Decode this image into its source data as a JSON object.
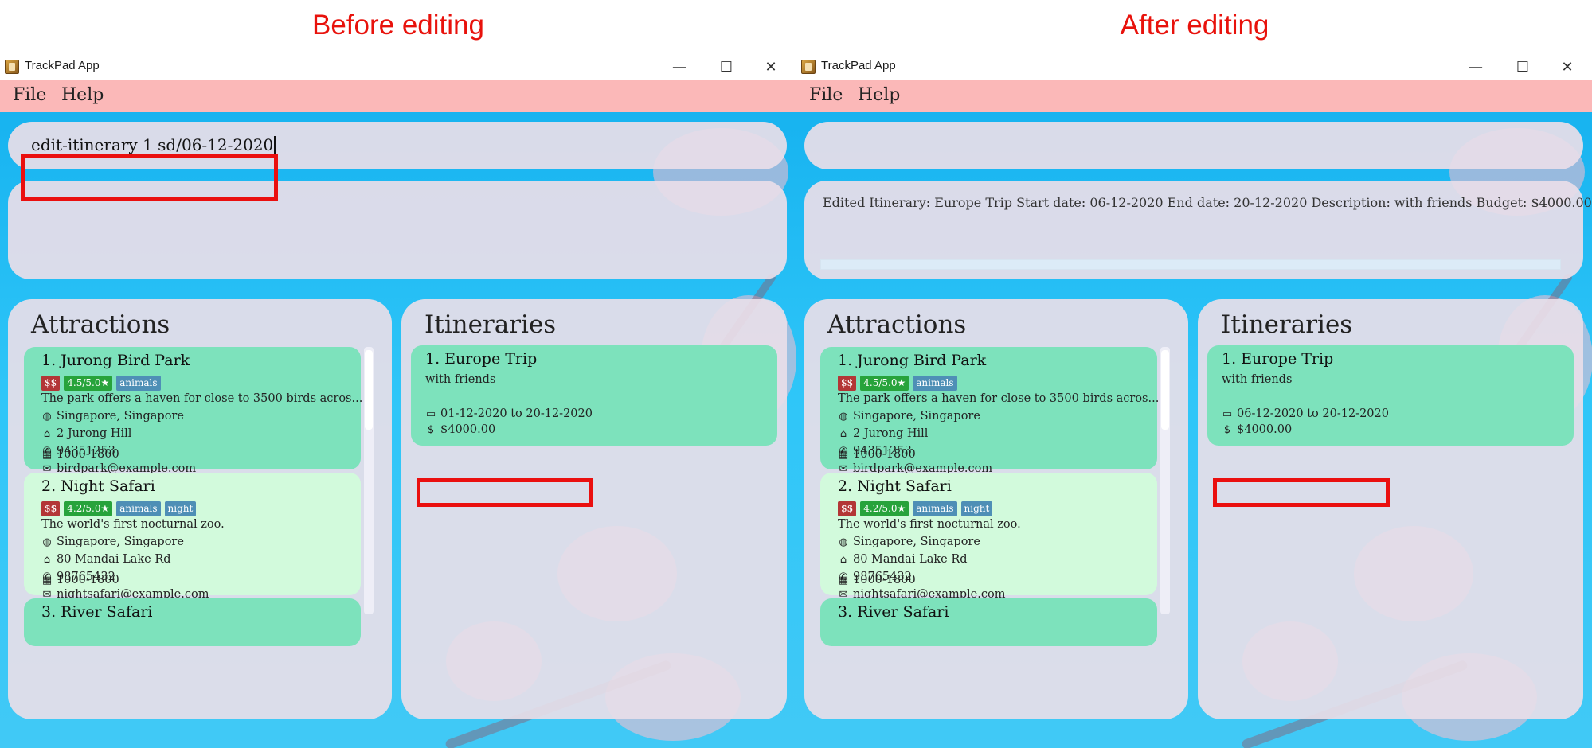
{
  "captions": {
    "before": "Before editing",
    "after": "After editing"
  },
  "app": {
    "title": "TrackPad App",
    "menu": {
      "file": "File",
      "help": "Help"
    }
  },
  "before": {
    "command": "edit-itinerary 1 sd/06-12-2020",
    "result": "",
    "itinerary": {
      "index_name": "1.  Europe Trip",
      "description": "with friends",
      "dates": "01-12-2020 to 20-12-2020",
      "budget": "$4000.00"
    }
  },
  "after": {
    "command": "",
    "result": "Edited Itinerary: Europe Trip Start date: 06-12-2020 End date: 20-12-2020 Description: with friends Budget: $4000.00",
    "itinerary": {
      "index_name": "1.  Europe Trip",
      "description": "with friends",
      "dates": "06-12-2020 to 20-12-2020",
      "budget": "$4000.00"
    }
  },
  "panels": {
    "attractions": "Attractions",
    "itineraries": "Itineraries"
  },
  "attractions": [
    {
      "index_name": "1.  Jurong Bird Park",
      "price": "$$",
      "rating": "4.5/5.0★",
      "tags": [
        "animals"
      ],
      "description": "The park offers a haven for close to 3500 birds acros...",
      "location": "Singapore, Singapore",
      "address": "2 Jurong Hill",
      "phone": "94351253",
      "email": "birdpark@example.com",
      "hours": "1000-1800"
    },
    {
      "index_name": "2.  Night Safari",
      "price": "$$",
      "rating": "4.2/5.0★",
      "tags": [
        "animals",
        "night"
      ],
      "description": "The world's first nocturnal zoo.",
      "location": "Singapore, Singapore",
      "address": "80 Mandai Lake Rd",
      "phone": "98765432",
      "email": "nightsafari@example.com",
      "hours": "1000-1800"
    },
    {
      "index_name": "3.  River Safari"
    }
  ],
  "icons": {
    "location": "globe-icon",
    "address": "home-icon",
    "phone": "phone-icon",
    "email": "mail-icon",
    "hours": "calendar-grid-icon",
    "dates": "calendar-icon",
    "budget": "dollar-icon"
  },
  "colors": {
    "caption": "#e8120c",
    "menubar": "#fbb8b8",
    "card_selected": "#7de2bc",
    "card_alt": "#d2fadc",
    "price_tag": "#b33636",
    "rating_tag": "#27a33b",
    "label_tag": "#4e8fb6",
    "highlight": "#ea0f0f"
  }
}
